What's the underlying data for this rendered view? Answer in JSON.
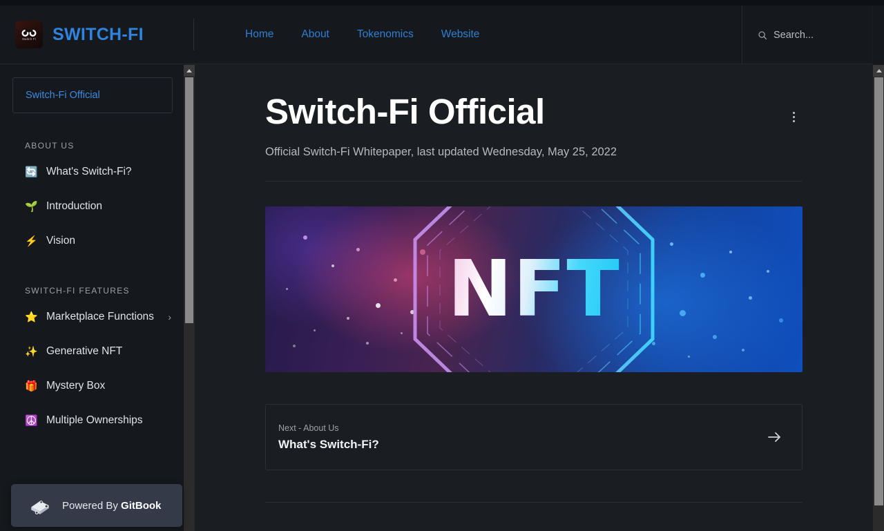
{
  "header": {
    "logo_alt": "Switch Fi",
    "logo_sub_text": "Switch Fi",
    "brand_name": "SWITCH-FI",
    "nav": [
      {
        "label": "Home"
      },
      {
        "label": "About"
      },
      {
        "label": "Tokenomics"
      },
      {
        "label": "Website"
      }
    ],
    "search": {
      "placeholder": "Search...",
      "value": "Search..."
    }
  },
  "sidebar": {
    "space_label": "Switch-Fi Official",
    "sections": [
      {
        "title": "ABOUT US",
        "items": [
          {
            "emoji": "🔄",
            "label": "What's Switch-Fi?",
            "expandable": false
          },
          {
            "emoji": "🌱",
            "label": "Introduction",
            "expandable": false
          },
          {
            "emoji": "⚡",
            "label": "Vision",
            "expandable": false
          }
        ]
      },
      {
        "title": "SWITCH-FI FEATURES",
        "items": [
          {
            "emoji": "⭐",
            "label": "Marketplace Functions",
            "expandable": true,
            "chevron": "›"
          },
          {
            "emoji": "✨",
            "label": "Generative NFT",
            "expandable": false
          },
          {
            "emoji": "🎁",
            "label": "Mystery Box",
            "expandable": false
          },
          {
            "emoji": "☮️",
            "label": "Multiple Ownerships",
            "expandable": false
          }
        ]
      }
    ],
    "footer_badge": {
      "prefix": "Powered By ",
      "brand": "GitBook"
    }
  },
  "main": {
    "page_title": "Switch-Fi Official",
    "page_subtitle": "Official Switch-Fi Whitepaper, last updated Wednesday, May 25, 2022",
    "banner": {
      "text": "NFT",
      "alt": "NFT hexagon banner"
    },
    "next_card": {
      "kicker": "Next - About Us",
      "title": "What's Switch-Fi?"
    }
  },
  "colors": {
    "brand_blue": "#2f84e0",
    "nav_link": "#2f7fd4",
    "sidebar_bg": "#15181c",
    "main_bg": "#1a1d21",
    "gitbook_badge": "#343a47"
  }
}
